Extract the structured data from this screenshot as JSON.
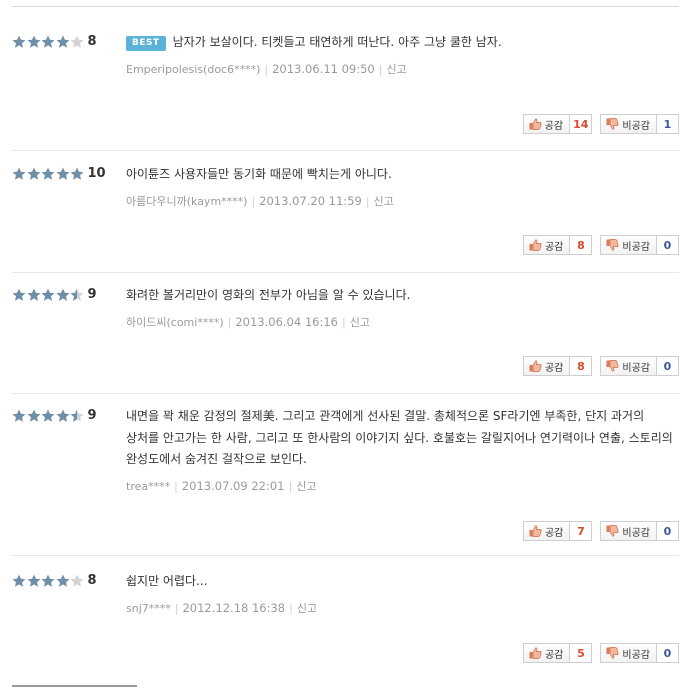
{
  "colors": {
    "star_filled": "#6f8ea8",
    "star_empty": "#d3d3d3",
    "best_badge": "#5bb2d9",
    "like_count": "#d94b2b",
    "dislike_count": "#3b5998"
  },
  "labels": {
    "like": "공감",
    "dislike": "비공감",
    "report": "신고",
    "best": "BEST"
  },
  "reviews": [
    {
      "stars": 4,
      "score": "8",
      "best": true,
      "text": "남자가 보살이다. 티켓들고 태연하게 떠난다. 아주 그냥 쿨한 남자.",
      "author": "Emperipolesis(doc6****)",
      "date": "2013.06.11 09:50",
      "likes": "14",
      "dislikes": "1"
    },
    {
      "stars": 5,
      "score": "10",
      "best": false,
      "text": "아이튠즈 사용자들만 동기화 때문에 빡치는게 아니다.",
      "author": "아름다우니까(kaym****)",
      "date": "2013.07.20 11:59",
      "likes": "8",
      "dislikes": "0"
    },
    {
      "stars": 4.5,
      "score": "9",
      "best": false,
      "text": "화려한 볼거리만이 영화의 전부가 아님을 알 수 있습니다.",
      "author": "하이드씨(comi****)",
      "date": "2013.06.04 16:16",
      "likes": "8",
      "dislikes": "0"
    },
    {
      "stars": 4.5,
      "score": "9",
      "best": false,
      "text": "내면을 꽉 채운 감정의 절제美. 그리고 관객에게 선사된 결말. 총체적으론 SF라기엔 부족한, 단지 과거의 상처를 안고가는 한 사람, 그리고 또 한사람의 이야기지 싶다. 호불호는 갈릴지어나 연기력이나 연출, 스토리의 완성도에서 숨겨진 걸작으로 보인다.",
      "author": "trea****",
      "date": "2013.07.09 22:01",
      "likes": "7",
      "dislikes": "0"
    },
    {
      "stars": 4,
      "score": "8",
      "best": false,
      "text": "쉽지만 어렵다...",
      "author": "snj7****",
      "date": "2012.12.18 16:38",
      "likes": "5",
      "dislikes": "0"
    }
  ]
}
